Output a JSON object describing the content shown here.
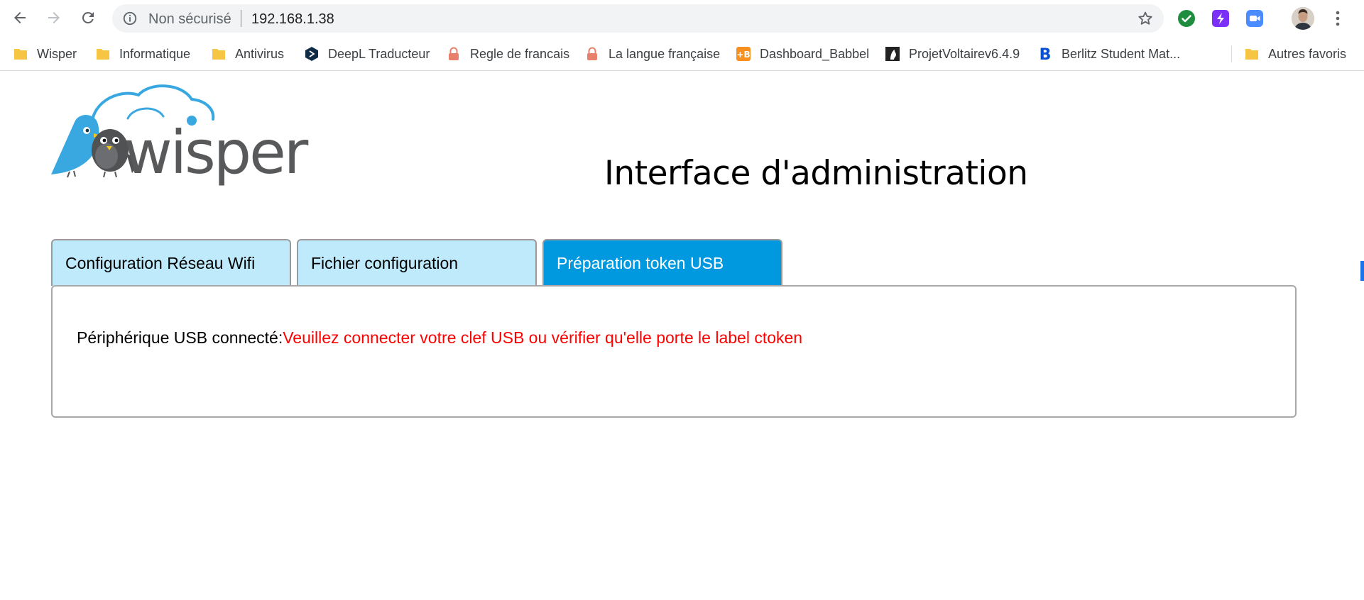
{
  "browser": {
    "address_bar": {
      "security_label": "Non sécurisé",
      "url": "192.168.1.38"
    },
    "bookmarks": [
      {
        "label": "Wisper",
        "icon": "folder-icon"
      },
      {
        "label": "Informatique",
        "icon": "folder-icon"
      },
      {
        "label": "Antivirus",
        "icon": "folder-icon"
      },
      {
        "label": "DeepL Traducteur",
        "icon": "deepl-icon"
      },
      {
        "label": "Regle de francais",
        "icon": "lock-icon"
      },
      {
        "label": "La langue française",
        "icon": "lock-icon"
      },
      {
        "label": "Dashboard_Babbel",
        "icon": "babbel-icon"
      },
      {
        "label": "ProjetVoltairev6.4.9",
        "icon": "voltaire-icon"
      },
      {
        "label": "Berlitz Student Mat...",
        "icon": "berlitz-icon"
      }
    ],
    "other_bookmarks": {
      "label": "Autres favoris",
      "icon": "folder-icon"
    },
    "extensions": [
      "check-extension-icon",
      "purple-extension-icon",
      "zoom-extension-icon"
    ]
  },
  "page": {
    "logo_text": "wisper",
    "title": "Interface d'administration",
    "tabs": [
      {
        "label": "Configuration Réseau Wifi",
        "active": false
      },
      {
        "label": "Fichier configuration",
        "active": false
      },
      {
        "label": "Préparation token USB",
        "active": true
      }
    ],
    "panel": {
      "status_label": "Périphérique USB connecté:",
      "status_message": "Veuillez connecter votre clef USB ou vérifier qu'elle porte le label ctoken"
    }
  },
  "colors": {
    "tab_inactive": "#bfeafb",
    "tab_active": "#0099e0",
    "error_text": "#ff0000",
    "logo_blue": "#3aa8e0",
    "logo_gray": "#555555"
  }
}
